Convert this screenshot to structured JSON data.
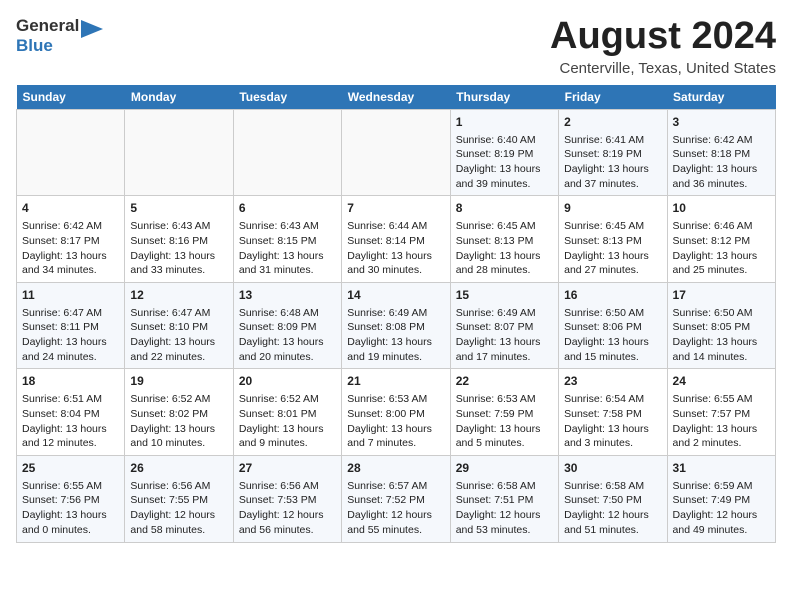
{
  "header": {
    "logo_line1": "General",
    "logo_line2": "Blue",
    "main_title": "August 2024",
    "subtitle": "Centerville, Texas, United States"
  },
  "days_of_week": [
    "Sunday",
    "Monday",
    "Tuesday",
    "Wednesday",
    "Thursday",
    "Friday",
    "Saturday"
  ],
  "weeks": [
    [
      {
        "day": "",
        "info": ""
      },
      {
        "day": "",
        "info": ""
      },
      {
        "day": "",
        "info": ""
      },
      {
        "day": "",
        "info": ""
      },
      {
        "day": "1",
        "info": "Sunrise: 6:40 AM\nSunset: 8:19 PM\nDaylight: 13 hours\nand 39 minutes."
      },
      {
        "day": "2",
        "info": "Sunrise: 6:41 AM\nSunset: 8:19 PM\nDaylight: 13 hours\nand 37 minutes."
      },
      {
        "day": "3",
        "info": "Sunrise: 6:42 AM\nSunset: 8:18 PM\nDaylight: 13 hours\nand 36 minutes."
      }
    ],
    [
      {
        "day": "4",
        "info": "Sunrise: 6:42 AM\nSunset: 8:17 PM\nDaylight: 13 hours\nand 34 minutes."
      },
      {
        "day": "5",
        "info": "Sunrise: 6:43 AM\nSunset: 8:16 PM\nDaylight: 13 hours\nand 33 minutes."
      },
      {
        "day": "6",
        "info": "Sunrise: 6:43 AM\nSunset: 8:15 PM\nDaylight: 13 hours\nand 31 minutes."
      },
      {
        "day": "7",
        "info": "Sunrise: 6:44 AM\nSunset: 8:14 PM\nDaylight: 13 hours\nand 30 minutes."
      },
      {
        "day": "8",
        "info": "Sunrise: 6:45 AM\nSunset: 8:13 PM\nDaylight: 13 hours\nand 28 minutes."
      },
      {
        "day": "9",
        "info": "Sunrise: 6:45 AM\nSunset: 8:13 PM\nDaylight: 13 hours\nand 27 minutes."
      },
      {
        "day": "10",
        "info": "Sunrise: 6:46 AM\nSunset: 8:12 PM\nDaylight: 13 hours\nand 25 minutes."
      }
    ],
    [
      {
        "day": "11",
        "info": "Sunrise: 6:47 AM\nSunset: 8:11 PM\nDaylight: 13 hours\nand 24 minutes."
      },
      {
        "day": "12",
        "info": "Sunrise: 6:47 AM\nSunset: 8:10 PM\nDaylight: 13 hours\nand 22 minutes."
      },
      {
        "day": "13",
        "info": "Sunrise: 6:48 AM\nSunset: 8:09 PM\nDaylight: 13 hours\nand 20 minutes."
      },
      {
        "day": "14",
        "info": "Sunrise: 6:49 AM\nSunset: 8:08 PM\nDaylight: 13 hours\nand 19 minutes."
      },
      {
        "day": "15",
        "info": "Sunrise: 6:49 AM\nSunset: 8:07 PM\nDaylight: 13 hours\nand 17 minutes."
      },
      {
        "day": "16",
        "info": "Sunrise: 6:50 AM\nSunset: 8:06 PM\nDaylight: 13 hours\nand 15 minutes."
      },
      {
        "day": "17",
        "info": "Sunrise: 6:50 AM\nSunset: 8:05 PM\nDaylight: 13 hours\nand 14 minutes."
      }
    ],
    [
      {
        "day": "18",
        "info": "Sunrise: 6:51 AM\nSunset: 8:04 PM\nDaylight: 13 hours\nand 12 minutes."
      },
      {
        "day": "19",
        "info": "Sunrise: 6:52 AM\nSunset: 8:02 PM\nDaylight: 13 hours\nand 10 minutes."
      },
      {
        "day": "20",
        "info": "Sunrise: 6:52 AM\nSunset: 8:01 PM\nDaylight: 13 hours\nand 9 minutes."
      },
      {
        "day": "21",
        "info": "Sunrise: 6:53 AM\nSunset: 8:00 PM\nDaylight: 13 hours\nand 7 minutes."
      },
      {
        "day": "22",
        "info": "Sunrise: 6:53 AM\nSunset: 7:59 PM\nDaylight: 13 hours\nand 5 minutes."
      },
      {
        "day": "23",
        "info": "Sunrise: 6:54 AM\nSunset: 7:58 PM\nDaylight: 13 hours\nand 3 minutes."
      },
      {
        "day": "24",
        "info": "Sunrise: 6:55 AM\nSunset: 7:57 PM\nDaylight: 13 hours\nand 2 minutes."
      }
    ],
    [
      {
        "day": "25",
        "info": "Sunrise: 6:55 AM\nSunset: 7:56 PM\nDaylight: 13 hours\nand 0 minutes."
      },
      {
        "day": "26",
        "info": "Sunrise: 6:56 AM\nSunset: 7:55 PM\nDaylight: 12 hours\nand 58 minutes."
      },
      {
        "day": "27",
        "info": "Sunrise: 6:56 AM\nSunset: 7:53 PM\nDaylight: 12 hours\nand 56 minutes."
      },
      {
        "day": "28",
        "info": "Sunrise: 6:57 AM\nSunset: 7:52 PM\nDaylight: 12 hours\nand 55 minutes."
      },
      {
        "day": "29",
        "info": "Sunrise: 6:58 AM\nSunset: 7:51 PM\nDaylight: 12 hours\nand 53 minutes."
      },
      {
        "day": "30",
        "info": "Sunrise: 6:58 AM\nSunset: 7:50 PM\nDaylight: 12 hours\nand 51 minutes."
      },
      {
        "day": "31",
        "info": "Sunrise: 6:59 AM\nSunset: 7:49 PM\nDaylight: 12 hours\nand 49 minutes."
      }
    ]
  ]
}
